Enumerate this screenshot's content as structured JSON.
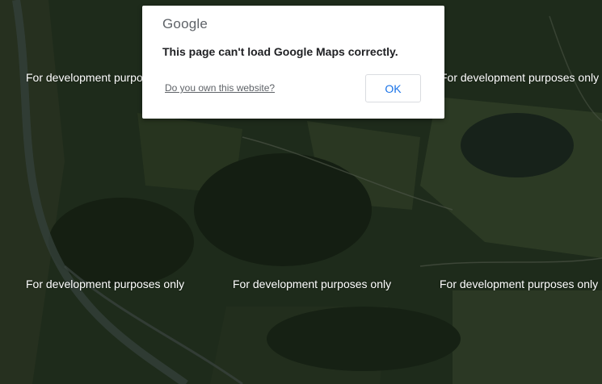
{
  "dialog": {
    "logo_text": "Google",
    "message": "This page can't load Google Maps correctly.",
    "link_label": "Do you own this website?",
    "ok_label": "OK"
  },
  "watermarks": [
    "For development purposes only",
    "For development purposes only",
    "For development purposes only",
    "For development purposes only",
    "For development purposes only"
  ],
  "colors": {
    "map_dark_green": "#1d2a1a",
    "button_text": "#1a73e8",
    "dialog_bg": "#ffffff"
  }
}
